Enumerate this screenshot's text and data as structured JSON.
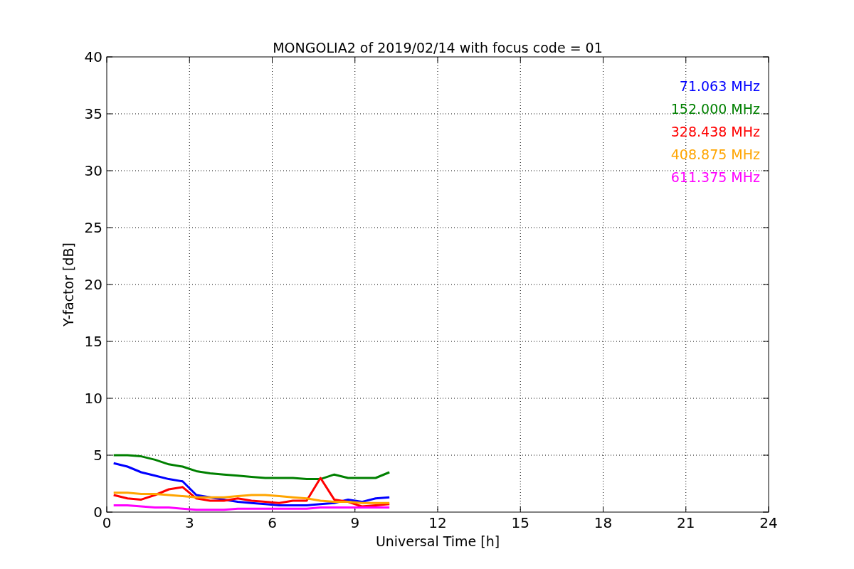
{
  "chart_data": {
    "type": "line",
    "title": "MONGOLIA2 of 2019/02/14 with focus code = 01",
    "xlabel": "Universal Time [h]",
    "ylabel": "Y-factor [dB]",
    "x": [
      0.25,
      0.75,
      1.25,
      1.75,
      2.25,
      2.75,
      3.25,
      3.75,
      4.25,
      4.75,
      5.25,
      5.75,
      6.25,
      6.75,
      7.25,
      7.75,
      8.25,
      8.75,
      9.25,
      9.75,
      10.25
    ],
    "series": [
      {
        "name": "71.063 MHz",
        "color": "#0000ff",
        "values": [
          4.3,
          4.0,
          3.5,
          3.2,
          2.9,
          2.7,
          1.5,
          1.3,
          1.1,
          0.9,
          0.8,
          0.7,
          0.6,
          0.6,
          0.6,
          0.7,
          0.8,
          1.1,
          0.9,
          1.2,
          1.3
        ]
      },
      {
        "name": "152.000 MHz",
        "color": "#008000",
        "values": [
          5.0,
          5.0,
          4.9,
          4.6,
          4.2,
          4.0,
          3.6,
          3.4,
          3.3,
          3.2,
          3.1,
          3.0,
          3.0,
          3.0,
          2.9,
          2.9,
          3.3,
          3.0,
          3.0,
          3.0,
          3.5
        ]
      },
      {
        "name": "328.438 MHz",
        "color": "#ff0000",
        "values": [
          1.5,
          1.2,
          1.1,
          1.5,
          2.0,
          2.2,
          1.2,
          1.0,
          1.0,
          1.2,
          1.0,
          0.9,
          0.8,
          1.0,
          1.0,
          3.0,
          1.1,
          0.9,
          0.5,
          0.6,
          0.7
        ]
      },
      {
        "name": "408.875 MHz",
        "color": "#ffa500",
        "values": [
          1.7,
          1.7,
          1.6,
          1.6,
          1.5,
          1.4,
          1.3,
          1.3,
          1.3,
          1.4,
          1.5,
          1.5,
          1.4,
          1.3,
          1.2,
          1.0,
          0.9,
          0.9,
          0.8,
          0.8,
          0.8
        ]
      },
      {
        "name": "611.375 MHz",
        "color": "#ff00ff",
        "values": [
          0.6,
          0.6,
          0.5,
          0.4,
          0.4,
          0.3,
          0.2,
          0.2,
          0.2,
          0.3,
          0.3,
          0.3,
          0.3,
          0.3,
          0.3,
          0.4,
          0.4,
          0.4,
          0.4,
          0.4,
          0.4
        ]
      }
    ],
    "xlim": [
      0,
      24
    ],
    "ylim": [
      0,
      40
    ],
    "xticks": [
      0,
      3,
      6,
      9,
      12,
      15,
      18,
      21,
      24
    ],
    "yticks": [
      0,
      5,
      10,
      15,
      20,
      25,
      30,
      35,
      40
    ],
    "grid": true
  }
}
